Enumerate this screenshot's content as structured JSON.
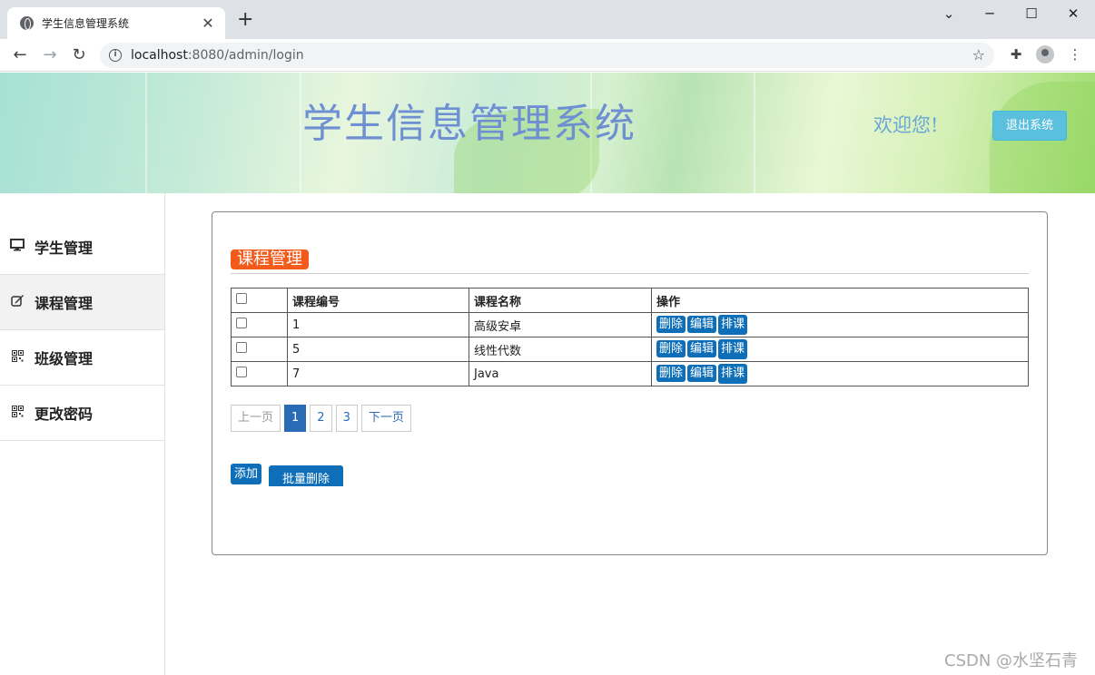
{
  "browser": {
    "tab_title": "学生信息管理系统",
    "tab_close": "✕",
    "new_tab": "+",
    "url_host": "localhost",
    "url_rest": ":8080/admin/login",
    "window": {
      "minimize": "⌄",
      "maximize": "☐",
      "restore": "─",
      "close": "✕"
    }
  },
  "header": {
    "site_title": "学生信息管理系统",
    "welcome": "欢迎您!",
    "logout_label": "退出系统"
  },
  "sidebar": {
    "items": [
      {
        "label": "学生管理",
        "icon": "monitor-icon",
        "active": false
      },
      {
        "label": "课程管理",
        "icon": "edit-icon",
        "active": true
      },
      {
        "label": "班级管理",
        "icon": "qrcode-icon",
        "active": false
      },
      {
        "label": "更改密码",
        "icon": "qrcode-icon",
        "active": false
      }
    ]
  },
  "main": {
    "section_title": "课程管理",
    "table": {
      "headers": [
        "",
        "课程编号",
        "课程名称",
        "操作"
      ],
      "rows": [
        {
          "id": "1",
          "name": "高级安卓"
        },
        {
          "id": "5",
          "name": "线性代数"
        },
        {
          "id": "7",
          "name": "Java"
        }
      ],
      "actions": {
        "delete": "删除",
        "edit": "编辑",
        "schedule": "排课"
      }
    },
    "pager": {
      "prev": "上一页",
      "pages": [
        "1",
        "2",
        "3"
      ],
      "current": "1",
      "next": "下一页"
    },
    "add_label": "添加",
    "batch_delete_label": "批量删除"
  },
  "watermark": "CSDN @水坚石青",
  "colors": {
    "accent": "#0e6fb8",
    "section_badge": "#f25b1c",
    "logout": "#5bc0de",
    "title_text": "#6e8fd2"
  }
}
